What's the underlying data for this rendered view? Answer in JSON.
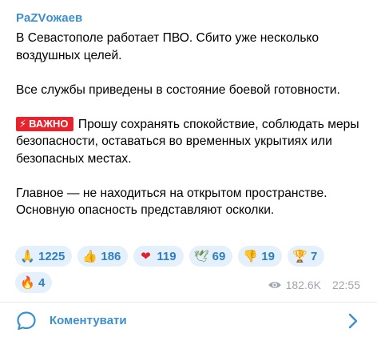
{
  "channel": {
    "name": "PaZVожаев"
  },
  "message": {
    "p1": "В Севастополе работает ПВО. Сбито уже несколько воздушных целей.",
    "p2": "Все службы приведены в состояние боевой готовности.",
    "badge": {
      "icon": "⚡",
      "label": "ВАЖНО"
    },
    "p3": "Прошу сохранять спокойствие, соблюдать меры безопасности, оставаться во временных укрытиях или безопасных местах.",
    "p4": "Главное — не находиться на открытом пространстве. Основную опасность представляют осколки."
  },
  "reactions": [
    {
      "icon_name": "pray-icon",
      "emoji": "🙏",
      "count": "1225"
    },
    {
      "icon_name": "thumbs-up-icon",
      "emoji": "👍",
      "count": "186"
    },
    {
      "icon_name": "heart-icon",
      "emoji": "❤",
      "count": "119"
    },
    {
      "icon_name": "dove-icon",
      "emoji": "🕊",
      "count": "69"
    },
    {
      "icon_name": "thumbs-down-icon",
      "emoji": "👎",
      "count": "19"
    },
    {
      "icon_name": "trophy-icon",
      "emoji": "🏆",
      "count": "7"
    },
    {
      "icon_name": "fire-icon",
      "emoji": "🔥",
      "count": "4"
    }
  ],
  "meta": {
    "views": "182.6K",
    "time": "22:55"
  },
  "comments": {
    "label": "Коментувати"
  },
  "colors": {
    "accent": "#3a8fd1",
    "badge": "#e8232d",
    "reaction_bg": "#e4f0fb",
    "meta": "#a0a6ad"
  }
}
